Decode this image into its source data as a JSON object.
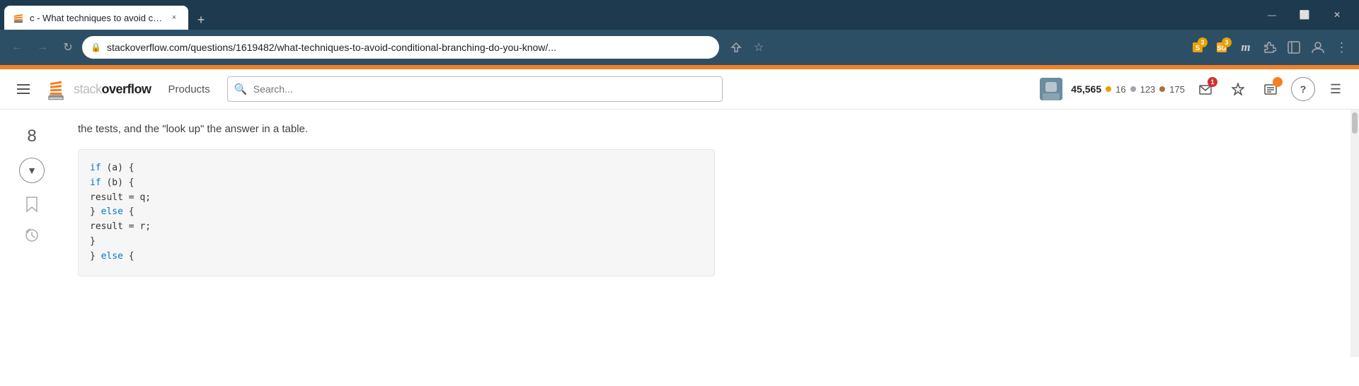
{
  "browser": {
    "tab": {
      "favicon": "SO",
      "title": "c - What techniques to avoid co...",
      "close_label": "×"
    },
    "new_tab_label": "+",
    "window_controls": {
      "minimize": "—",
      "maximize": "⬜",
      "close": "✕"
    },
    "nav": {
      "back": "←",
      "forward": "→",
      "reload": "↻"
    },
    "address": {
      "lock_icon": "🔒",
      "url": "stackoverflow.com/questions/1619482/what-techniques-to-avoid-conditional-branching-do-you-know/...",
      "share_icon": "⬆",
      "star_icon": "☆"
    },
    "toolbar": {
      "ext1_badge": "3",
      "ext2_badge": "3",
      "monospace_icon": "m",
      "puzzle_icon": "🧩",
      "sidebar_icon": "⬛",
      "profile_icon": "👤",
      "menu_icon": "⋮"
    }
  },
  "so_header": {
    "hamburger_label": "menu",
    "logo_text_plain": "stack",
    "logo_text_bold": "overflow",
    "products_label": "Products",
    "search_placeholder": "Search...",
    "user": {
      "reputation": "45,565",
      "gold_count": "16",
      "silver_count": "123",
      "bronze_count": "175"
    },
    "icons": {
      "inbox": "💬",
      "inbox_badge": "1",
      "achievements": "🏆",
      "review": "📋",
      "help": "?",
      "hamburger2": "☰"
    }
  },
  "content": {
    "vote_count": "8",
    "answer_text": "the tests, and the \"look up\" the answer in a table.",
    "code_lines": [
      {
        "text": "if (a) {",
        "keyword_positions": [
          {
            "word": "if",
            "type": "keyword"
          }
        ]
      },
      {
        "text": "  if (b) {",
        "keyword_positions": [
          {
            "word": "if",
            "type": "keyword"
          }
        ]
      },
      {
        "text": "    result = q;",
        "keyword_positions": []
      },
      {
        "text": "  } else {",
        "keyword_positions": [
          {
            "word": "else",
            "type": "keyword"
          }
        ]
      },
      {
        "text": "    result = r;",
        "keyword_positions": []
      },
      {
        "text": "  }",
        "keyword_positions": []
      },
      {
        "text": "} else {",
        "keyword_positions": [
          {
            "word": "else",
            "type": "keyword"
          }
        ]
      }
    ]
  }
}
